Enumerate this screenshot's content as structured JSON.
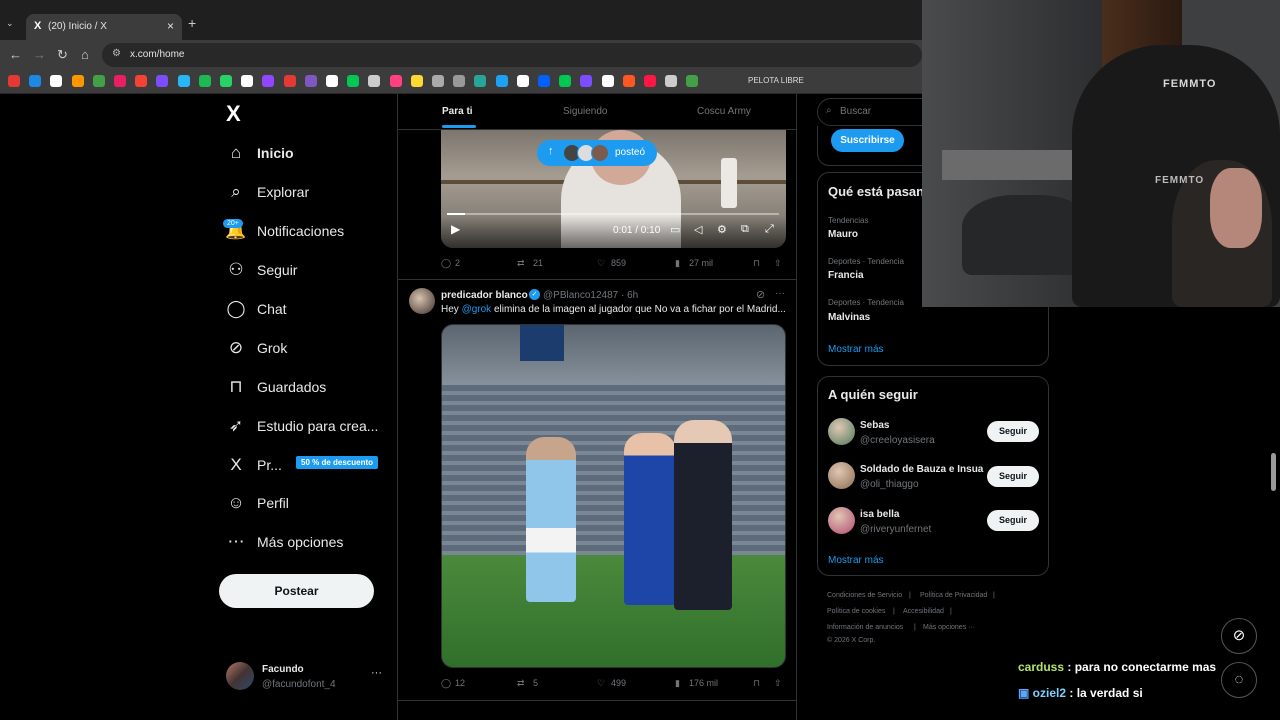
{
  "browser": {
    "tab_title": "(20) Inicio / X",
    "tab_favicon": "X",
    "tab_close": "×",
    "new_tab": "+",
    "url": "x.com/home",
    "bookmark_label": "PELOTA LIBRE",
    "bookmark_colors": [
      "#e53935",
      "#1e88e5",
      "#ffffff",
      "#ff9800",
      "#43a047",
      "#e91e63",
      "#f44336",
      "#7c4dff",
      "#29b6f6",
      "#1db954",
      "#25d366",
      "#ffffff",
      "#9146ff",
      "#e53935",
      "#7e57c2",
      "#ffffff",
      "#00c853",
      "#cccccc",
      "#ff4081",
      "#fdd835",
      "#aaaaaa",
      "#999999",
      "#26a69a",
      "#1da1f2",
      "#ffffff",
      "#0061ff",
      "#00c853",
      "#7c4dff",
      "#ffffff",
      "#ff5722",
      "#ff1744",
      "#cccccc",
      "#43a047"
    ]
  },
  "nav": {
    "logo": "X",
    "items": [
      {
        "label": "Inicio",
        "icon": "home-icon",
        "glyph": "⌂"
      },
      {
        "label": "Explorar",
        "icon": "search-icon",
        "glyph": "⌕"
      },
      {
        "label": "Notificaciones",
        "icon": "bell-icon",
        "glyph": "🔔"
      },
      {
        "label": "Seguir",
        "icon": "follow-icon",
        "glyph": "⚇"
      },
      {
        "label": "Chat",
        "icon": "chat-icon",
        "glyph": "◯"
      },
      {
        "label": "Grok",
        "icon": "grok-icon",
        "glyph": "⊘"
      },
      {
        "label": "Guardados",
        "icon": "bookmark-icon",
        "glyph": "⊓"
      },
      {
        "label": "Estudio para crea...",
        "icon": "rocket-icon",
        "glyph": "➶"
      },
      {
        "label": "Pr...",
        "icon": "x-premium-icon",
        "glyph": "X"
      },
      {
        "label": "Perfil",
        "icon": "person-icon",
        "glyph": "☺"
      },
      {
        "label": "Más opciones",
        "icon": "more-circle-icon",
        "glyph": "⋯"
      }
    ],
    "notif_badge": "20+",
    "promo_badge": "50 % de descuento",
    "post_button": "Postear",
    "user_name": "Facundo",
    "user_handle": "@facundofont_4",
    "user_more": "···"
  },
  "feed": {
    "tabs": [
      "Para ti",
      "Siguiendo",
      "Coscu Army"
    ],
    "posted_pill": "posteó",
    "video_time": "0:01 / 0:10",
    "tweet1_stats": {
      "replies": "2",
      "reposts": "21",
      "likes": "859",
      "views": "27 mil"
    },
    "tweet2": {
      "name": "predicador blanco",
      "handle": "@PBlanco12487 · 6h",
      "text_before": "Hey ",
      "mention": "@grok",
      "text_after": " elimina de la imagen al jugador que No va a fichar por el Madrid..."
    },
    "tweet2_stats": {
      "replies": "12",
      "reposts": "5",
      "likes": "499",
      "views": "176 mil"
    }
  },
  "sidebar": {
    "search_placeholder": "Buscar",
    "subscribe": "Suscribirse",
    "trends_title": "Qué está pasan",
    "trends": [
      {
        "meta": "Tendencias",
        "name": "Mauro"
      },
      {
        "meta": "Deportes · Tendencia",
        "name": "Francia"
      },
      {
        "meta": "Deportes · Tendencia",
        "name": "Malvinas"
      }
    ],
    "show_more": "Mostrar más",
    "follow_title": "A quién seguir",
    "suggestions": [
      {
        "name": "Sebas",
        "handle": "@creeloyasisera",
        "button": "Seguir",
        "color": "#4e7a5a"
      },
      {
        "name": "Soldado de Bauza e Insua",
        "handle": "@oli_thiaggo",
        "button": "Seguir",
        "color": "#8a6d4e"
      },
      {
        "name": "isa bella",
        "handle": "@riveryunfernet",
        "button": "Seguir",
        "color": "#b04a6e"
      }
    ],
    "footer": {
      "terms": "Condiciones de Servicio",
      "privacy": "Política de Privacidad",
      "cookies": "Política de cookies",
      "accessibility": "Accesibilidad",
      "ads": "Información de anuncios",
      "more": "Más opciones ···",
      "copyright": "© 2026 X Corp."
    }
  },
  "webcam": {
    "brand_top": "FEMMTO",
    "brand_bottom": "FEMMTO"
  },
  "stream_chat": [
    {
      "user": "carduss",
      "message": " : para no conectarme mas"
    },
    {
      "user": "oziel2",
      "message": " : la verdad si"
    }
  ],
  "colors": {
    "accent": "#1d9bf0",
    "background": "#000000",
    "border": "#2f3336",
    "muted": "#71767b"
  }
}
